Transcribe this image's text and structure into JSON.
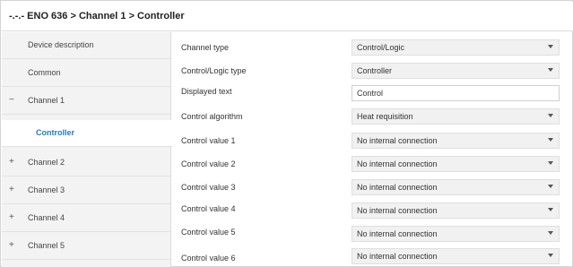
{
  "header": {
    "breadcrumb": "-.-.- ENO 636 > Channel 1 > Controller"
  },
  "sidebar": {
    "items": [
      {
        "prefix": "",
        "label": "Device description"
      },
      {
        "prefix": "",
        "label": "Common"
      },
      {
        "prefix": "−",
        "label": "Channel 1"
      },
      {
        "prefix": "",
        "label": "Controller"
      },
      {
        "prefix": "+",
        "label": "Channel 2"
      },
      {
        "prefix": "+",
        "label": "Channel 3"
      },
      {
        "prefix": "+",
        "label": "Channel 4"
      },
      {
        "prefix": "+",
        "label": "Channel 5"
      }
    ]
  },
  "params": [
    {
      "label": "Channel type",
      "value": "Control/Logic"
    },
    {
      "label": "Control/Logic type",
      "value": "Controller"
    },
    {
      "label": "Displayed text",
      "value": "Control"
    },
    {
      "label": "Control algorithm",
      "value": "Heat requisition"
    },
    {
      "label": "Control value 1",
      "value": "No internal connection"
    },
    {
      "label": "Control value 2",
      "value": "No internal connection"
    },
    {
      "label": "Control value 3",
      "value": "No internal connection"
    },
    {
      "label": "Control value 4",
      "value": "No internal connection"
    },
    {
      "label": "Control value 5",
      "value": "No internal connection"
    },
    {
      "label": "Control value 6",
      "value": "No internal connection"
    }
  ],
  "icons": {
    "expanded": "minus-icon",
    "collapsed": "plus-icon",
    "dropdown": "chevron-down-icon"
  },
  "colors": {
    "accent": "#2a7ab0",
    "sidebar_bg": "#f3f3f3",
    "field_bg": "#f1f1f1"
  }
}
